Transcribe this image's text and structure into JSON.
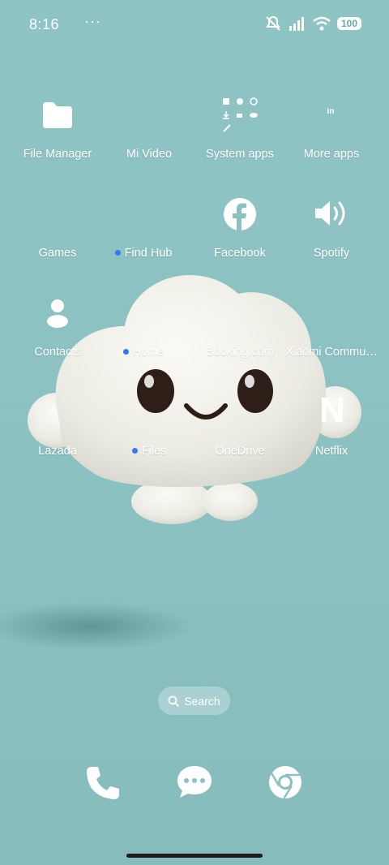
{
  "status_bar": {
    "time": "8:16",
    "more": "···",
    "battery": "100"
  },
  "rows": [
    [
      {
        "label": "File Manager",
        "dot": false
      },
      {
        "label": "Mi Video",
        "dot": false
      },
      {
        "label": "System apps",
        "dot": false
      },
      {
        "label": "More apps",
        "dot": false
      }
    ],
    [
      {
        "label": "Games",
        "dot": false
      },
      {
        "label": "Find Hub",
        "dot": true
      },
      {
        "label": "Facebook",
        "dot": false
      },
      {
        "label": "Spotify",
        "dot": false
      }
    ],
    [
      {
        "label": "Contacts",
        "dot": false
      },
      {
        "label": "Home",
        "dot": true
      },
      {
        "label": "Booking.com",
        "dot": false
      },
      {
        "label": "Xiaomi Commu…",
        "dot": false
      }
    ],
    [
      {
        "label": "Lazada",
        "dot": false
      },
      {
        "label": "Files",
        "dot": true
      },
      {
        "label": "OneDrive",
        "dot": false
      },
      {
        "label": "Netflix",
        "dot": false
      }
    ]
  ],
  "more_apps_glyph": "in",
  "netflix_glyph": "N",
  "search": {
    "label": "Search"
  },
  "dock": [
    "phone-icon",
    "messaging-icon",
    "chrome-icon"
  ]
}
